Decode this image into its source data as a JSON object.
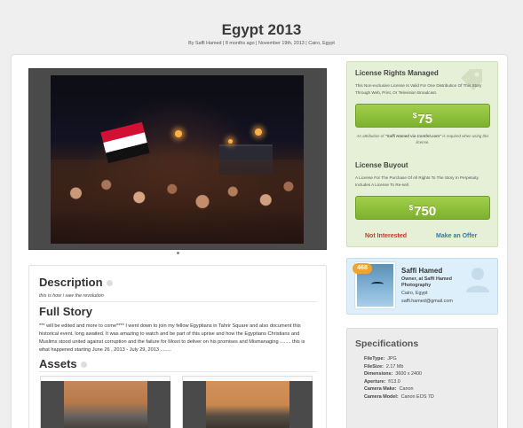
{
  "page": {
    "title": "Egypt 2013",
    "byline": {
      "prefix": "By",
      "author": "Saffi Hamed",
      "rest": " | 8 months ago | November 19th, 2013 | Cairo, Egypt"
    }
  },
  "description": {
    "title": "Description",
    "text": "this is how i saw the revolution"
  },
  "story": {
    "title": "Full Story",
    "text": "*** will be edited and more to come**** I went down to join my fellow Egyptians in Tahrir Square and also document this historical event, long awaited. It was amazing to watch and be part of this uprise and how the Egyptians Christians and Muslims stood united against corruption and the failure for Mosri to deliver on his promises and Mismanaging ........ this is what happened starting June 26 , 2013 - July 29, 2013 ........"
  },
  "assets": {
    "title": "Assets"
  },
  "license": {
    "managed_title": "License Rights Managed",
    "managed_text": "This Non-exclusive License Is Valid For One Distribution Of This Story Through Web, Print, Or Television Broadcast.",
    "managed_currency": "$",
    "managed_price": "75",
    "attribution_prefix": "An attribution of ",
    "attribution_credit": "\"Saffi Hamed via Contlnt.com\"",
    "attribution_suffix": " is required when using this license.",
    "buyout_title": "License Buyout",
    "buyout_text": "A License For The Purchase Of All Rights To The Story In Perpetuity. Includes A License To Re-sell.",
    "buyout_currency": "$",
    "buyout_price": "750",
    "not_interested": "Not Interested",
    "make_offer": "Make an Offer",
    "accent_green": "#8cbf3a",
    "decline_red": "#c0392b",
    "offer_blue": "#2c79b8"
  },
  "seller": {
    "badge_count": "468",
    "name": "Saffi Hamed",
    "role": "Owner, at Saffi Hamed Photography",
    "location": "Cairo, Egypt",
    "email": "saffi.hamed@gmail.com"
  },
  "specifications": {
    "title": "Specifications",
    "rows": [
      {
        "key": "FileType:",
        "value": "JPG"
      },
      {
        "key": "FileSize:",
        "value": "2.17 Mb"
      },
      {
        "key": "Dimensions:",
        "value": "3600 x 2400"
      },
      {
        "key": "Aperture:",
        "value": "f/13.0"
      },
      {
        "key": "Camera Make:",
        "value": "Canon"
      },
      {
        "key": "Camera Model:",
        "value": "Canon EOS 7D"
      }
    ]
  },
  "icons": {
    "tag": "tag-icon",
    "info": "info-icon",
    "user": "user-silhouette-icon"
  }
}
